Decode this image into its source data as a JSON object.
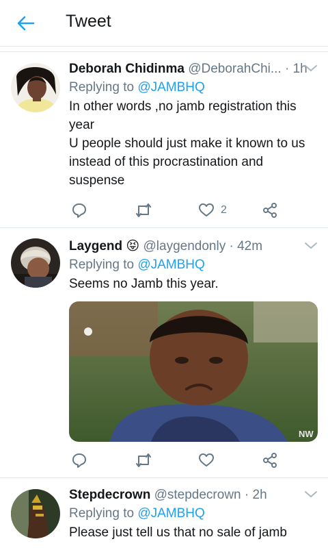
{
  "header": {
    "title": "Tweet",
    "back_icon": "arrow-left-icon",
    "accent": "#1da1f2"
  },
  "tweets": [
    {
      "name": "Deborah Chidinma",
      "handle": "@DeborahChi...",
      "time": "· 1h",
      "reply_prefix": "Replying to",
      "reply_to": "@JAMBHQ",
      "text_lines": [
        "In other words ,no jamb registration this year",
        "U people should just make it known to us instead of this procrastination and suspense"
      ],
      "likes": "2"
    },
    {
      "name": "Laygend",
      "emoji": "😝",
      "handle": "@laygendonly",
      "time": "· 42m",
      "reply_prefix": "Replying to",
      "reply_to": "@JAMBHQ",
      "text": "Seems no Jamb this year.",
      "media_watermark": "NW"
    },
    {
      "name": "Stepdecrown",
      "handle": "@stepdecrown",
      "time": "· 2h",
      "reply_prefix": "Replying to",
      "reply_to": "@JAMBHQ",
      "text": "Please just tell us that no sale of jamb"
    }
  ],
  "colors": {
    "secondary_text": "#657786",
    "divider": "#e1e8ed",
    "link": "#1da1f2"
  }
}
